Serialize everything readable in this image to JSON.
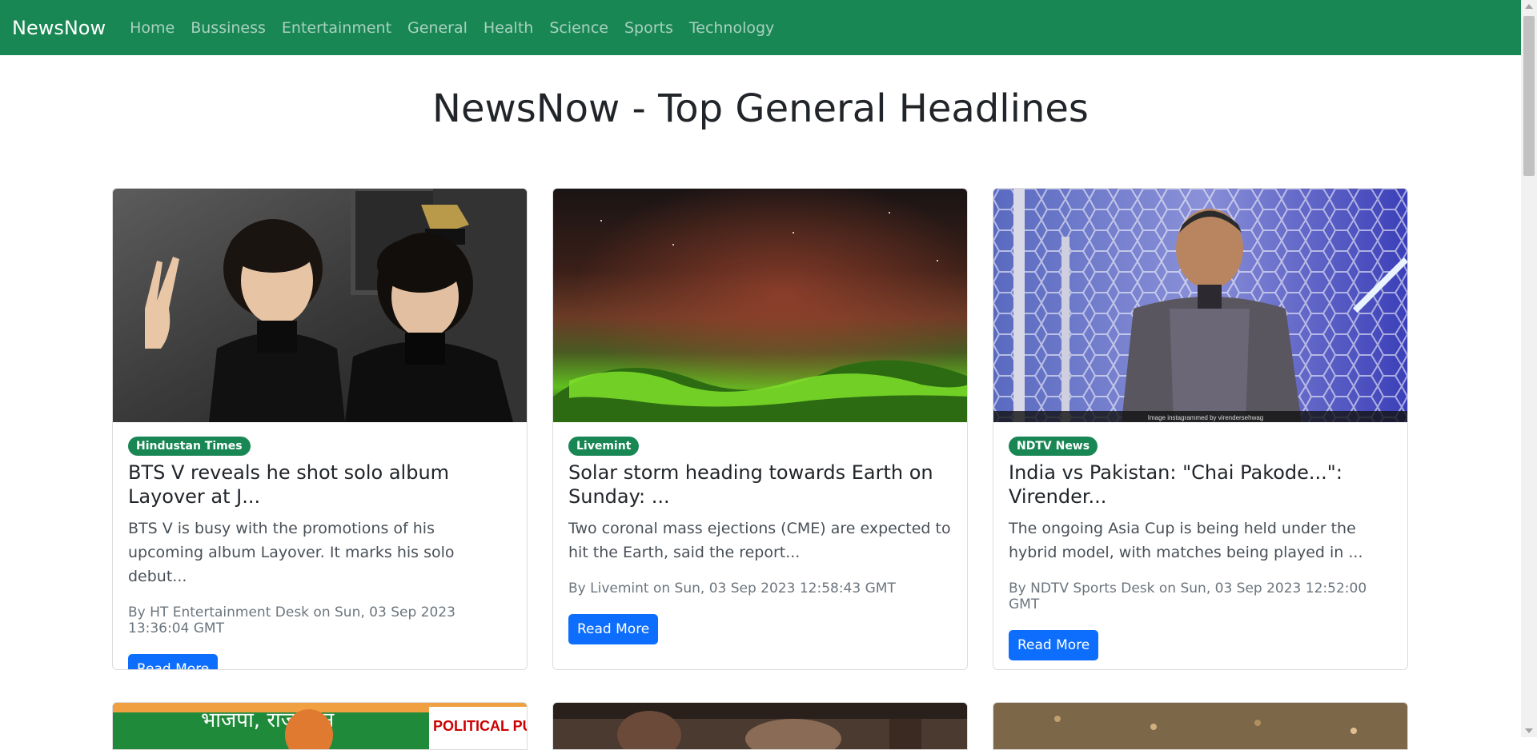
{
  "nav": {
    "brand": "NewsNow",
    "links": [
      "Home",
      "Bussiness",
      "Entertainment",
      "General",
      "Health",
      "Science",
      "Sports",
      "Technology"
    ]
  },
  "page_title": "NewsNow - Top General Headlines",
  "cards": [
    {
      "source": "Hindustan Times",
      "title": "BTS V reveals he shot solo album Layover at J...",
      "description": "BTS V is busy with the promotions of his upcoming album Layover. It marks his solo debut...",
      "meta": "By HT Entertainment Desk on Sun, 03 Sep 2023 13:36:04 GMT",
      "button": "Read More"
    },
    {
      "source": "Livemint",
      "title": "Solar storm heading towards Earth on Sunday: ...",
      "description": "Two coronal mass ejections (CME) are expected to hit the Earth, said the report...",
      "meta": "By Livemint on Sun, 03 Sep 2023 12:58:43 GMT",
      "button": "Read More"
    },
    {
      "source": "NDTV News",
      "title": "India vs Pakistan: \"Chai Pakode...\": Virender...",
      "description": "The ongoing Asia Cup is being held under the hybrid model, with matches being played in ...",
      "meta": "By NDTV Sports Desk on Sun, 03 Sep 2023 12:52:00 GMT",
      "button": "Read More",
      "image_caption": "Image instagrammed by virendersehwag"
    }
  ],
  "next_row_images": {
    "poster_text_hindi": "भाजपा, राजस्थान",
    "poster_text_brand": "POLITICAL PULSE"
  },
  "colors": {
    "navbar": "#198754",
    "badge": "#198754",
    "button": "#0d6efd"
  }
}
